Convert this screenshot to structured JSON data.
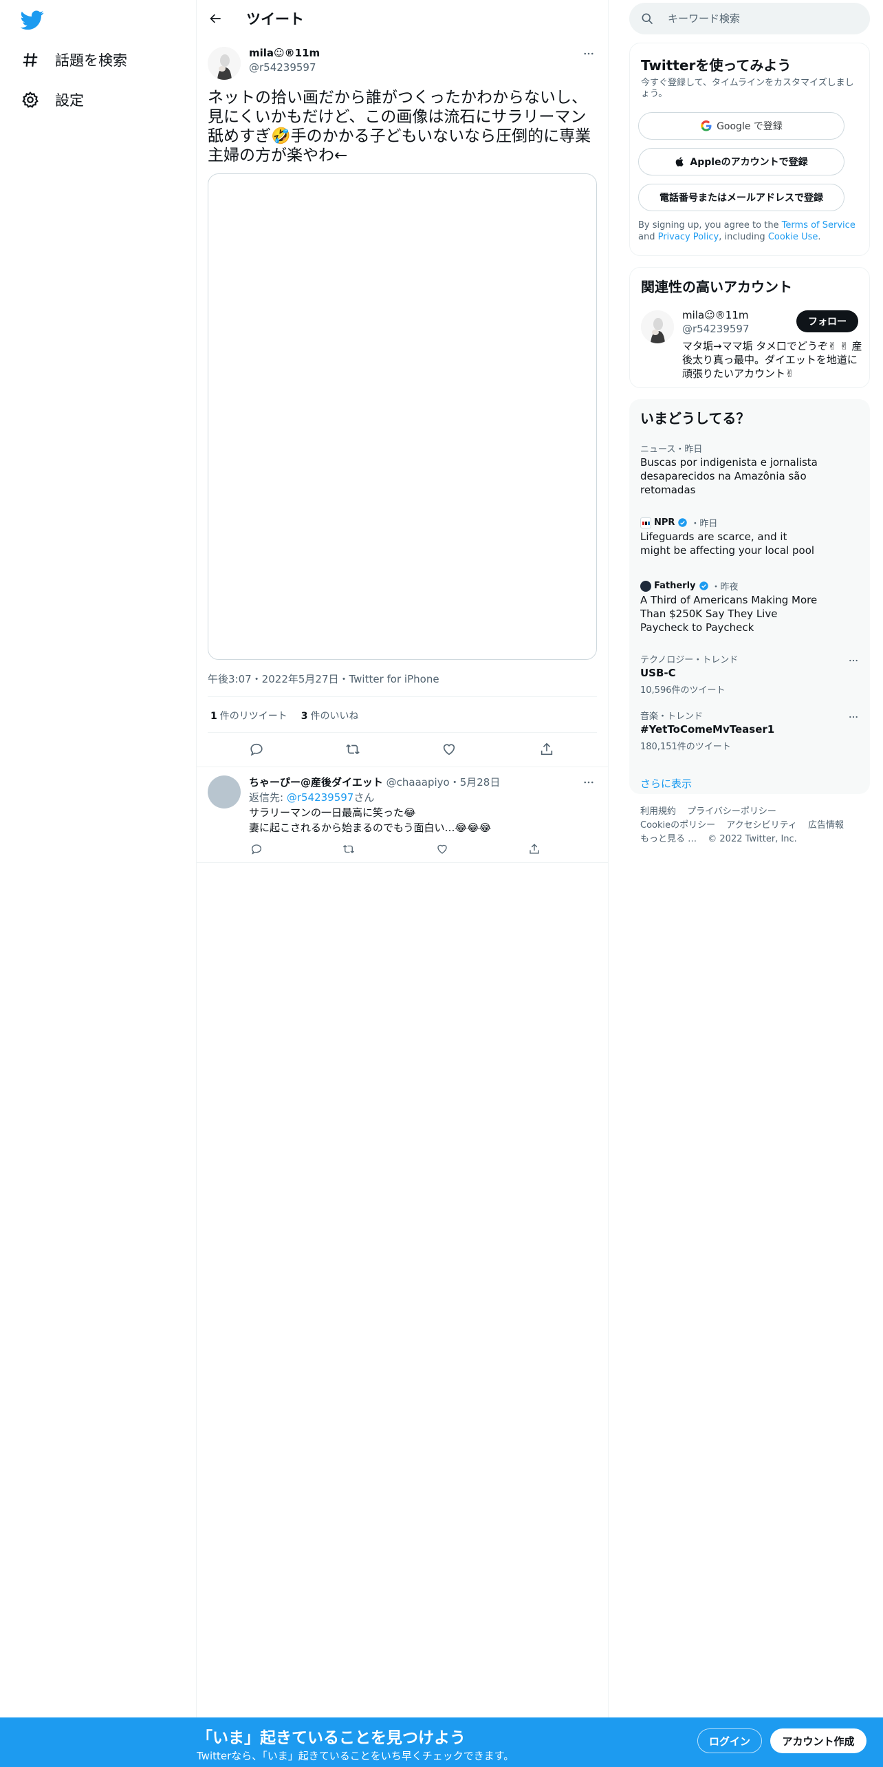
{
  "colors": {
    "accent": "#1d9bf0",
    "text": "#0f1419",
    "muted": "#536471"
  },
  "nav": {
    "logo_icon": "twitter-bird-icon",
    "items": [
      {
        "icon": "hashtag-icon",
        "label": "話題を検索"
      },
      {
        "icon": "gear-icon",
        "label": "設定"
      }
    ]
  },
  "header": {
    "back_icon": "back-arrow-icon",
    "title": "ツイート"
  },
  "tweet": {
    "author_name": "mila☺︎®11m",
    "author_handle": "@r54239597",
    "text": "ネットの拾い画だから誰がつくったかわからないし、見にくいかもだけど、この画像は流石にサラリーマン舐めすぎ🤣手のかかる子どもいないなら圧倒的に専業主婦の方が楽やわ←",
    "meta": "午後3:07・2022年5月27日・Twitter for iPhone",
    "retweet_count": "1",
    "retweet_label": "件のリツイート",
    "like_count": "3",
    "like_label": "件のいいね"
  },
  "reply": {
    "name": "ちゃーぴー@産後ダイエット",
    "handle_date": "@chaaapiyo・5月28日",
    "reply_prefix": "返信先: ",
    "reply_to": "@r54239597",
    "reply_suffix": "さん",
    "line1": "サラリーマンの一日最高に笑った😂",
    "line2": "妻に起こされるから始まるのでもう面白い…😂😂😂"
  },
  "search": {
    "placeholder": "キーワード検索"
  },
  "signup": {
    "title": "Twitterを使ってみよう",
    "subtitle": "今すぐ登録して、タイムラインをカスタマイズしましょう。",
    "google": "Google で登録",
    "apple": "Appleのアカウントで登録",
    "phone": "電話番号またはメールアドレスで登録",
    "terms_prefix": "By signing up, you agree to the ",
    "terms_link": "Terms of Service",
    "terms_and": " and ",
    "privacy_link": "Privacy Policy",
    "including": ", including ",
    "cookie_link": "Cookie Use",
    "period": "."
  },
  "related": {
    "title": "関連性の高いアカウント",
    "name": "mila☺︎®11m",
    "handle": "@r54239597",
    "follow": "フォロー",
    "bio": "マタ垢→ママ垢 タメ口でどうぞ✌︎ ✌︎ 産後太り真っ最中。ダイエットを地道に頑張りたいアカウント✌︎"
  },
  "trends": {
    "title": "いまどうしてる？",
    "items": [
      {
        "meta": "ニュース・昨日",
        "title": "Buscas por indigenista e jornalista desaparecidos na Amazônia são retomadas"
      },
      {
        "source": "NPR",
        "when": "・昨日",
        "title": "Lifeguards are scarce, and it might be affecting your local pool"
      },
      {
        "source": "Fatherly",
        "when": "・昨夜",
        "title": "A Third of Americans Making More Than $250K Say They Live Paycheck to Paycheck"
      },
      {
        "meta": "テクノロジー・トレンド",
        "title": "USB-C",
        "count": "10,596件のツイート"
      },
      {
        "meta": "音楽・トレンド",
        "title": "#YetToComeMvTeaser1",
        "count": "180,151件のツイート"
      }
    ],
    "show_more": "さらに表示"
  },
  "footer": {
    "links": [
      "利用規約",
      "プライバシーポリシー",
      "Cookieのポリシー",
      "アクセシビリティ",
      "広告情報",
      "もっと見る …",
      "© 2022 Twitter, Inc."
    ]
  },
  "bottom_bar": {
    "title": "「いま」起きていることを見つけよう",
    "subtitle": "Twitterなら、「いま」起きていることをいち早くチェックできます。",
    "login": "ログイン",
    "signup": "アカウント作成"
  }
}
